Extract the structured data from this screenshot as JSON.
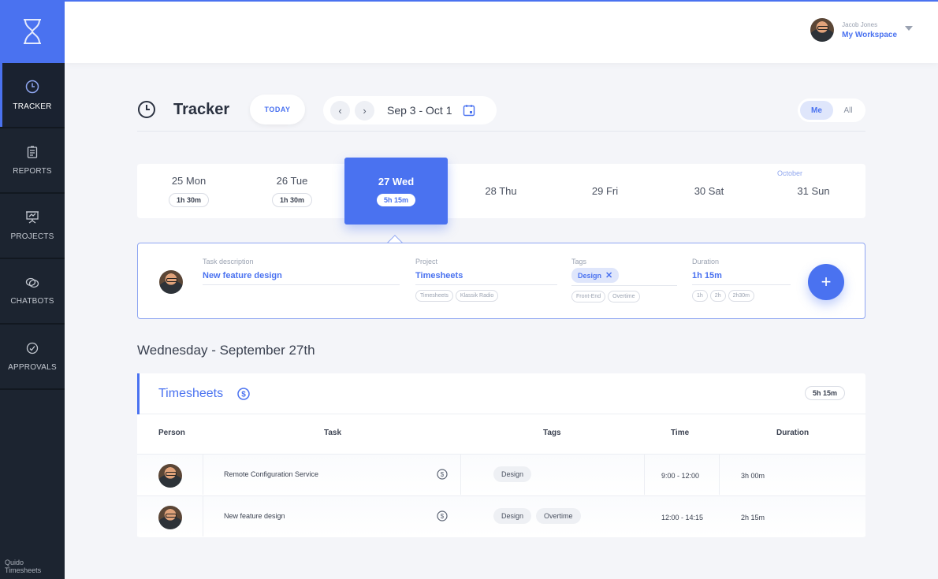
{
  "sidebar": {
    "items": [
      {
        "label": "TRACKER",
        "icon": "clock-icon",
        "active": true
      },
      {
        "label": "REPORTS",
        "icon": "clipboard-icon",
        "active": false
      },
      {
        "label": "PROJECTS",
        "icon": "presentation-icon",
        "active": false
      },
      {
        "label": "CHATBOTS",
        "icon": "chat-icon",
        "active": false
      },
      {
        "label": "APPROVALS",
        "icon": "check-circle-icon",
        "active": false
      }
    ],
    "footer_line1": "Quido",
    "footer_line2": "Timesheets"
  },
  "header": {
    "user_name": "Jacob Jones",
    "workspace": "My Workspace"
  },
  "tracker": {
    "title": "Tracker",
    "today_label": "TODAY",
    "prev_label": "‹",
    "next_label": "›",
    "range": "Sep 3 - Oct 1",
    "me_label": "Me",
    "all_label": "All"
  },
  "days": [
    {
      "label": "25 Mon",
      "total": "1h 30m"
    },
    {
      "label": "26 Tue",
      "total": "1h 30m"
    },
    {
      "label": "27 Wed",
      "total": "5h 15m",
      "active": true
    },
    {
      "label": "28 Thu",
      "total": ""
    },
    {
      "label": "29 Fri",
      "total": ""
    },
    {
      "label": "30 Sat",
      "total": ""
    },
    {
      "label": "31 Sun",
      "total": ""
    }
  ],
  "month_tag": "October",
  "entry": {
    "task_label": "Task description",
    "task_value": "New feature design",
    "project_label": "Project",
    "project_value": "Timesheets",
    "project_suggestions": [
      "Timesheets",
      "Klassik Radio"
    ],
    "tags_label": "Tags",
    "tag_value": "Design",
    "tag_remove": "✕",
    "tag_suggestions": [
      "Front-End",
      "Overtime"
    ],
    "duration_label": "Duration",
    "duration_value": "1h 15m",
    "duration_suggestions": [
      "1h",
      "2h",
      "2h30m"
    ],
    "add_label": "+"
  },
  "day_heading": "Wednesday - September 27th",
  "timesheets": {
    "title": "Timesheets",
    "total": "5h 15m",
    "columns": {
      "person": "Person",
      "task": "Task",
      "tags": "Tags",
      "time": "Time",
      "duration": "Duration"
    },
    "rows": [
      {
        "task": "Remote Configuration Service",
        "tags": [
          "Design"
        ],
        "time": "9:00 - 12:00",
        "duration": "3h 00m"
      },
      {
        "task": "New feature design",
        "tags": [
          "Design",
          "Overtime"
        ],
        "time": "12:00 - 14:15",
        "duration": "2h 15m"
      }
    ]
  },
  "colors": {
    "accent": "#4a72f0",
    "sidebar": "#1c2430",
    "background": "#f4f5f9"
  }
}
